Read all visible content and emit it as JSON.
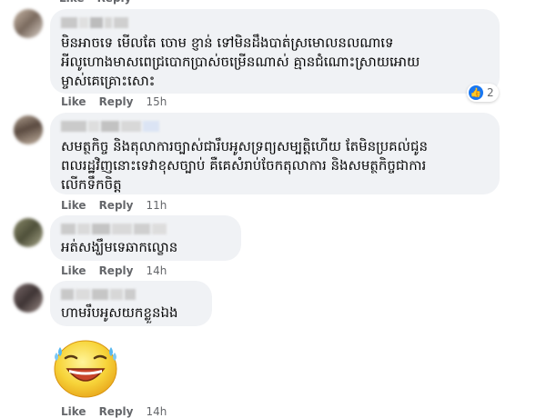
{
  "comments": [
    {
      "text": "មិនអាចទេ មើលតែ ចោម ខ្ញាន់ ទៅមិនដឹងបាត់ស្រមោលនលណាទេ\nអីលូហោងមាសពេជ្របោកប្រាស់ចម្រើនណាស់ គ្មានជំណោះស្រាយអោយ\nម្ចាស់គេគ្រោះសោះ",
      "like": "Like",
      "reply": "Reply",
      "time": "15h",
      "reaction_count": "2"
    },
    {
      "text": "សមត្ថកិច្ច និងតុលាការច្បាស់ជារឹបអូសទ្រព្យសម្បត្តិហើយ តែមិនប្រគល់ជូន\nពលរដ្ឋវិញនោះទេវាខុសច្បាប់ គឺគេសំរាប់ចែកតុលាការ និងសមត្ថកិច្ចជាការ\nលើកទឹកចិត្ត",
      "like": "Like",
      "reply": "Reply",
      "time": "11h"
    },
    {
      "text": "អត់សង្ឃឹមទេឆាកល្ខោន",
      "like": "Like",
      "reply": "Reply",
      "time": "14h"
    },
    {
      "text": "ហាមរឹបអូសយកខ្លួនឯង",
      "like": "Like",
      "reply": "Reply",
      "time": "14h"
    }
  ],
  "sticker": {
    "name": "laughing-emoji-sticker"
  },
  "colors": {
    "bubble": "#f0f2f5",
    "meta": "#65676b",
    "like_blue": "#1877f2",
    "text": "#050505"
  }
}
